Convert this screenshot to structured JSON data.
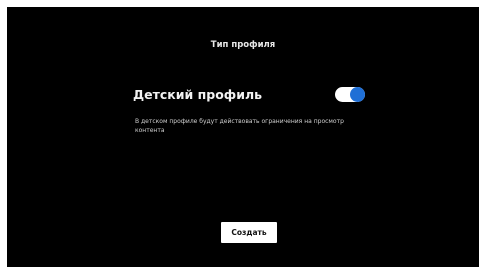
{
  "header": {
    "title": "Тип профиля"
  },
  "kids_profile": {
    "label": "Детский профиль",
    "toggle_state": "on",
    "description": "В детском профиле будут действовать ограничения на просмотр контента"
  },
  "actions": {
    "create_label": "Создать"
  },
  "colors": {
    "background": "#000000",
    "accent": "#1f6fd6",
    "text": "#ffffff"
  }
}
